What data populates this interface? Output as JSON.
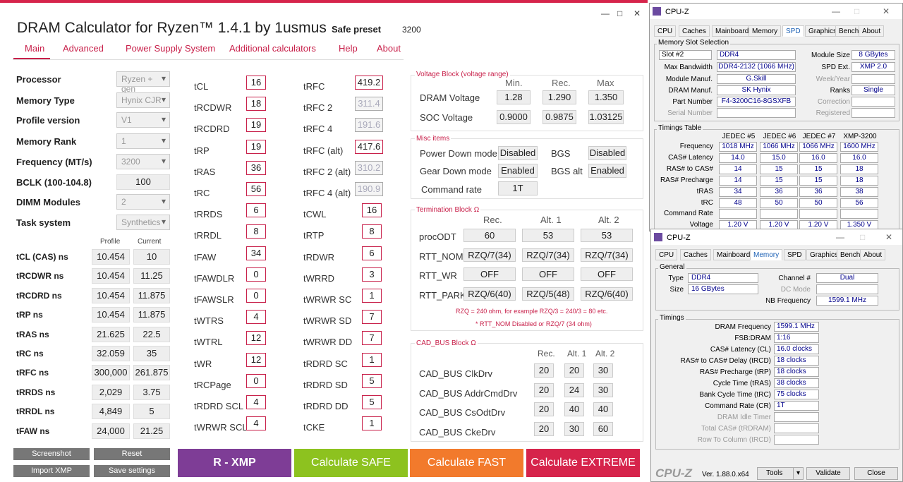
{
  "app": {
    "title": "DRAM Calculator for Ryzen™ 1.4.1 by 1usmus",
    "preset_label": "Safe preset",
    "preset_value": "3200",
    "win_min": "—",
    "win_max": "□",
    "win_close": "✕"
  },
  "nav": [
    "Main",
    "Advanced",
    "Power Supply System",
    "Additional calculators",
    "Help",
    "About"
  ],
  "left": [
    {
      "label": "Processor",
      "value": "Ryzen + gen"
    },
    {
      "label": "Memory Type",
      "value": "Hynix CJR"
    },
    {
      "label": "Profile version",
      "value": "V1"
    },
    {
      "label": "Memory Rank",
      "value": "1"
    },
    {
      "label": "Frequency (MT/s)",
      "value": "3200"
    },
    {
      "label": "BCLK (100-104.8)",
      "value": "100"
    },
    {
      "label": "DIMM Modules",
      "value": "2"
    },
    {
      "label": "Task system",
      "value": "Synthetics"
    }
  ],
  "ns_headers": {
    "profile": "Profile",
    "current": "Current"
  },
  "ns": [
    {
      "label": "tCL (CAS) ns",
      "profile": "10.454",
      "current": "10"
    },
    {
      "label": "tRCDWR ns",
      "profile": "10.454",
      "current": "11.25"
    },
    {
      "label": "tRCDRD ns",
      "profile": "10.454",
      "current": "11.875"
    },
    {
      "label": "tRP ns",
      "profile": "10.454",
      "current": "11.875"
    },
    {
      "label": "tRAS ns",
      "profile": "21.625",
      "current": "22.5"
    },
    {
      "label": "tRC ns",
      "profile": "32.059",
      "current": "35"
    },
    {
      "label": "tRFC ns",
      "profile": "300,000",
      "current": "261.875"
    },
    {
      "label": "tRRDS ns",
      "profile": "2,029",
      "current": "3.75"
    },
    {
      "label": "tRRDL ns",
      "profile": "4,849",
      "current": "5"
    },
    {
      "label": "tFAW ns",
      "profile": "24,000",
      "current": "21.25"
    }
  ],
  "timings1": [
    {
      "l": "tCL",
      "v": "16"
    },
    {
      "l": "tRCDWR",
      "v": "18"
    },
    {
      "l": "tRCDRD",
      "v": "19"
    },
    {
      "l": "tRP",
      "v": "19"
    },
    {
      "l": "tRAS",
      "v": "36"
    },
    {
      "l": "tRC",
      "v": "56"
    },
    {
      "l": "tRRDS",
      "v": "6"
    },
    {
      "l": "tRRDL",
      "v": "8"
    },
    {
      "l": "tFAW",
      "v": "34"
    },
    {
      "l": "tFAWDLR",
      "v": "0"
    },
    {
      "l": "tFAWSLR",
      "v": "0"
    },
    {
      "l": "tWTRS",
      "v": "4"
    },
    {
      "l": "tWTRL",
      "v": "12"
    },
    {
      "l": "tWR",
      "v": "12"
    },
    {
      "l": "tRCPage",
      "v": "0"
    },
    {
      "l": "tRDRD SCL",
      "v": "4"
    },
    {
      "l": "tWRWR SCL",
      "v": "4"
    }
  ],
  "timings2": [
    {
      "l": "tRFC",
      "v": "419.2",
      "g": false
    },
    {
      "l": "tRFC 2",
      "v": "311.4",
      "g": true
    },
    {
      "l": "tRFC 4",
      "v": "191.6",
      "g": true
    },
    {
      "l": "tRFC (alt)",
      "v": "417.6",
      "g": false
    },
    {
      "l": "tRFC 2 (alt)",
      "v": "310.2",
      "g": true
    },
    {
      "l": "tRFC 4 (alt)",
      "v": "190.9",
      "g": true
    },
    {
      "l": "tCWL",
      "v": "16",
      "g": false
    },
    {
      "l": "tRTP",
      "v": "8",
      "g": false
    },
    {
      "l": "tRDWR",
      "v": "6",
      "g": false
    },
    {
      "l": "tWRRD",
      "v": "3",
      "g": false
    },
    {
      "l": "tWRWR SC",
      "v": "1",
      "g": false
    },
    {
      "l": "tWRWR SD",
      "v": "7",
      "g": false
    },
    {
      "l": "tWRWR DD",
      "v": "7",
      "g": false
    },
    {
      "l": "tRDRD SC",
      "v": "1",
      "g": false
    },
    {
      "l": "tRDRD SD",
      "v": "5",
      "g": false
    },
    {
      "l": "tRDRD DD",
      "v": "5",
      "g": false
    },
    {
      "l": "tCKE",
      "v": "1",
      "g": false
    }
  ],
  "voltage": {
    "title": "Voltage Block (voltage range)",
    "cols": [
      "Min.",
      "Rec.",
      "Max"
    ],
    "rows": [
      {
        "l": "DRAM Voltage",
        "v": [
          "1.28",
          "1.290",
          "1.350"
        ]
      },
      {
        "l": "SOC Voltage",
        "v": [
          "0.9000",
          "0.9875",
          "1.03125"
        ]
      }
    ]
  },
  "misc": {
    "title": "Misc items",
    "pdm": "Power Down mode",
    "pdm_v": "Disabled",
    "bgs": "BGS",
    "bgs_v": "Disabled",
    "gdm": "Gear Down mode",
    "gdm_v": "Enabled",
    "bgsalt": "BGS alt",
    "bgsalt_v": "Enabled",
    "cr": "Command rate",
    "cr_v": "1T"
  },
  "term": {
    "title": "Termination Block Ω",
    "cols": [
      "Rec.",
      "Alt. 1",
      "Alt. 2"
    ],
    "rows": [
      {
        "l": "procODT",
        "v": [
          "60",
          "53",
          "53"
        ]
      },
      {
        "l": "RTT_NOM*",
        "v": [
          "RZQ/7(34)",
          "RZQ/7(34)",
          "RZQ/7(34)"
        ]
      },
      {
        "l": "RTT_WR",
        "v": [
          "OFF",
          "OFF",
          "OFF"
        ]
      },
      {
        "l": "RTT_PARK",
        "v": [
          "RZQ/6(40)",
          "RZQ/5(48)",
          "RZQ/6(40)"
        ]
      }
    ],
    "note1": "RZQ = 240 ohm, for example RZQ/3 = 240/3 = 80 etc.",
    "note2": "* RTT_NOM Disabled or RZQ/7 (34 ohm)"
  },
  "cad": {
    "title": "CAD_BUS Block Ω",
    "cols": [
      "Rec.",
      "Alt. 1",
      "Alt. 2"
    ],
    "rows": [
      {
        "l": "CAD_BUS ClkDrv",
        "v": [
          "20",
          "20",
          "30"
        ]
      },
      {
        "l": "CAD_BUS AddrCmdDrv",
        "v": [
          "20",
          "24",
          "30"
        ]
      },
      {
        "l": "CAD_BUS CsOdtDrv",
        "v": [
          "20",
          "40",
          "40"
        ]
      },
      {
        "l": "CAD_BUS CkeDrv",
        "v": [
          "20",
          "30",
          "60"
        ]
      }
    ]
  },
  "buttons": {
    "screenshot": "Screenshot",
    "reset": "Reset",
    "import": "Import XMP",
    "save": "Save settings",
    "rxmp": "R - XMP",
    "safe": "Calculate SAFE",
    "fast": "Calculate FAST",
    "extreme": "Calculate EXTREME"
  },
  "colors": {
    "accent": "#c8204a",
    "xmp": "#7e3d96",
    "safe": "#8dc21f",
    "fast": "#f27a2c",
    "extreme": "#d6244b"
  },
  "cpuz1": {
    "title": "CPU-Z",
    "tabs": [
      "CPU",
      "Caches",
      "Mainboard",
      "Memory",
      "SPD",
      "Graphics",
      "Bench",
      "About"
    ],
    "active": "SPD",
    "slot_group": "Memory Slot Selection",
    "slot": "Slot #2",
    "type": "DDR4",
    "module_size_l": "Module Size",
    "module_size": "8 GBytes",
    "max_bw_l": "Max Bandwidth",
    "max_bw": "DDR4-2132 (1066 MHz)",
    "spd_ext_l": "SPD Ext.",
    "spd_ext": "XMP 2.0",
    "manuf_l": "Module Manuf.",
    "manuf": "G.Skill",
    "week_l": "Week/Year",
    "dram_manuf_l": "DRAM Manuf.",
    "dram_manuf": "SK Hynix",
    "ranks_l": "Ranks",
    "ranks": "Single",
    "pn_l": "Part Number",
    "pn": "F4-3200C16-8GSXFB",
    "corr_l": "Correction",
    "sn_l": "Serial Number",
    "reg_l": "Registered",
    "tt": "Timings Table",
    "cols": [
      "JEDEC #5",
      "JEDEC #6",
      "JEDEC #7",
      "XMP-3200"
    ],
    "rows": [
      {
        "l": "Frequency",
        "v": [
          "1018 MHz",
          "1066 MHz",
          "1066 MHz",
          "1600 MHz"
        ]
      },
      {
        "l": "CAS# Latency",
        "v": [
          "14.0",
          "15.0",
          "16.0",
          "16.0"
        ]
      },
      {
        "l": "RAS# to CAS#",
        "v": [
          "14",
          "15",
          "15",
          "18"
        ]
      },
      {
        "l": "RAS# Precharge",
        "v": [
          "14",
          "15",
          "15",
          "18"
        ]
      },
      {
        "l": "tRAS",
        "v": [
          "34",
          "36",
          "36",
          "38"
        ]
      },
      {
        "l": "tRC",
        "v": [
          "48",
          "50",
          "50",
          "56"
        ]
      },
      {
        "l": "Command Rate",
        "v": [
          "",
          "",
          "",
          ""
        ]
      },
      {
        "l": "Voltage",
        "v": [
          "1.20 V",
          "1.20 V",
          "1.20 V",
          "1.350 V"
        ]
      }
    ]
  },
  "cpuz2": {
    "title": "CPU-Z",
    "tabs": [
      "CPU",
      "Caches",
      "Mainboard",
      "Memory",
      "SPD",
      "Graphics",
      "Bench",
      "About"
    ],
    "active": "Memory",
    "general": "General",
    "type_l": "Type",
    "type": "DDR4",
    "channel_l": "Channel #",
    "channel": "Dual",
    "size_l": "Size",
    "size": "16 GBytes",
    "dc_l": "DC Mode",
    "nb_l": "NB Frequency",
    "nb": "1599.1 MHz",
    "timings": "Timings",
    "rows": [
      {
        "l": "DRAM Frequency",
        "v": "1599.1 MHz"
      },
      {
        "l": "FSB:DRAM",
        "v": "1:16"
      },
      {
        "l": "CAS# Latency (CL)",
        "v": "16.0 clocks"
      },
      {
        "l": "RAS# to CAS# Delay (tRCD)",
        "v": "18 clocks"
      },
      {
        "l": "RAS# Precharge (tRP)",
        "v": "18 clocks"
      },
      {
        "l": "Cycle Time (tRAS)",
        "v": "38 clocks"
      },
      {
        "l": "Bank Cycle Time (tRC)",
        "v": "75 clocks"
      },
      {
        "l": "Command Rate (CR)",
        "v": "1T"
      }
    ],
    "grey_rows": [
      "DRAM Idle Timer",
      "Total CAS# (tRDRAM)",
      "Row To Column (tRCD)"
    ],
    "brand": "CPU-Z",
    "version": "Ver. 1.88.0.x64",
    "tools": "Tools",
    "validate": "Validate",
    "close": "Close"
  }
}
